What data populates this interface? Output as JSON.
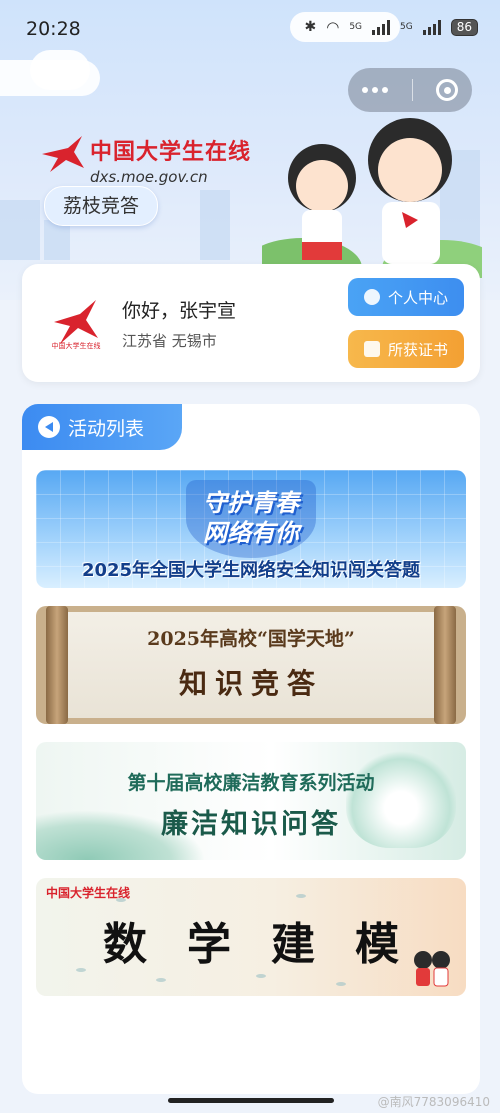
{
  "status_bar": {
    "time": "20:28",
    "net1": "5G",
    "net2": "5G",
    "battery": "86"
  },
  "brand": {
    "title": "中国大学生在线",
    "url": "dxs.moe.gov.cn",
    "logo_small": "中国大学生在线"
  },
  "tag": "荔枝竞答",
  "user": {
    "greeting": "你好，张宇宣",
    "location": "江苏省 无锡市",
    "personal_center": "个人中心",
    "certificate": "所获证书"
  },
  "activities": {
    "title": "活动列表",
    "items": [
      {
        "line1": "守护青春\n网络有你",
        "line2": "2025年全国大学生网络安全知识闯关答题"
      },
      {
        "line1": "2025年高校“国学天地”",
        "line2": "知识竞答"
      },
      {
        "line1": "第十届高校廉洁教育系列活动",
        "line2": "廉洁知识问答"
      },
      {
        "line1": "数学建模"
      }
    ]
  },
  "watermark": "@南风7783096410",
  "colors": {
    "brand_red": "#d9232d",
    "accent_blue": "#3c8bf1",
    "accent_orange": "#f3a033"
  }
}
